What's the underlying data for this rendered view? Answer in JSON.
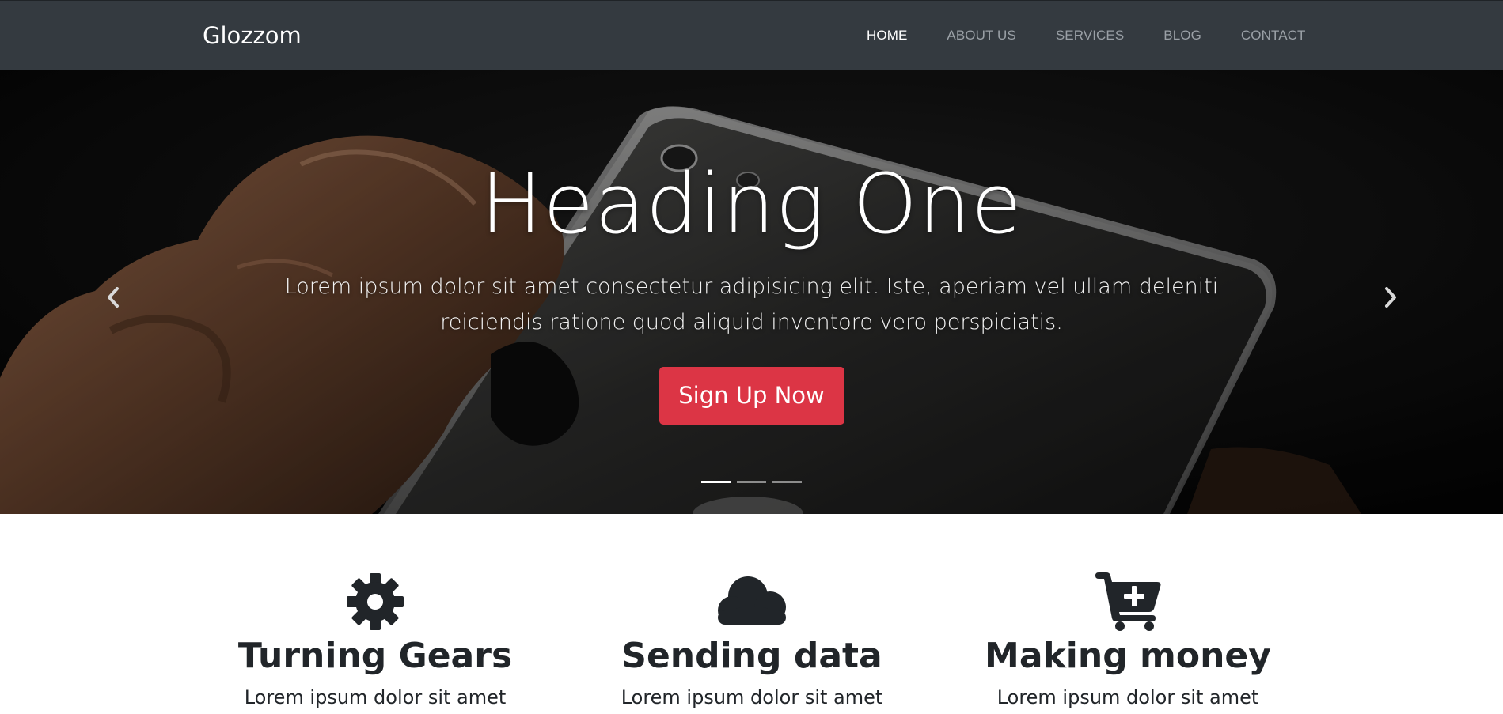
{
  "navbar": {
    "brand": "Glozzom",
    "links": [
      {
        "label": "HOME",
        "active": true
      },
      {
        "label": "ABOUT US",
        "active": false
      },
      {
        "label": "SERVICES",
        "active": false
      },
      {
        "label": "BLOG",
        "active": false
      },
      {
        "label": "CONTACT",
        "active": false
      }
    ],
    "background": "#343a40"
  },
  "hero": {
    "heading": "Heading One",
    "text": "Lorem ipsum dolor sit amet consectetur adipisicing elit. Iste, aperiam vel ullam deleniti reiciendis ratione quod aliquid inventore vero perspiciatis.",
    "button_label": "Sign Up Now",
    "button_color": "#dc3545",
    "prev_icon": "chevron-left-icon",
    "next_icon": "chevron-right-icon",
    "slide_count": 3,
    "active_slide": 1
  },
  "features": [
    {
      "icon": "gear-icon",
      "title": "Turning Gears",
      "text": "Lorem ipsum dolor sit amet"
    },
    {
      "icon": "cloud-icon",
      "title": "Sending data",
      "text": "Lorem ipsum dolor sit amet"
    },
    {
      "icon": "cart-plus-icon",
      "title": "Making money",
      "text": "Lorem ipsum dolor sit amet"
    }
  ]
}
